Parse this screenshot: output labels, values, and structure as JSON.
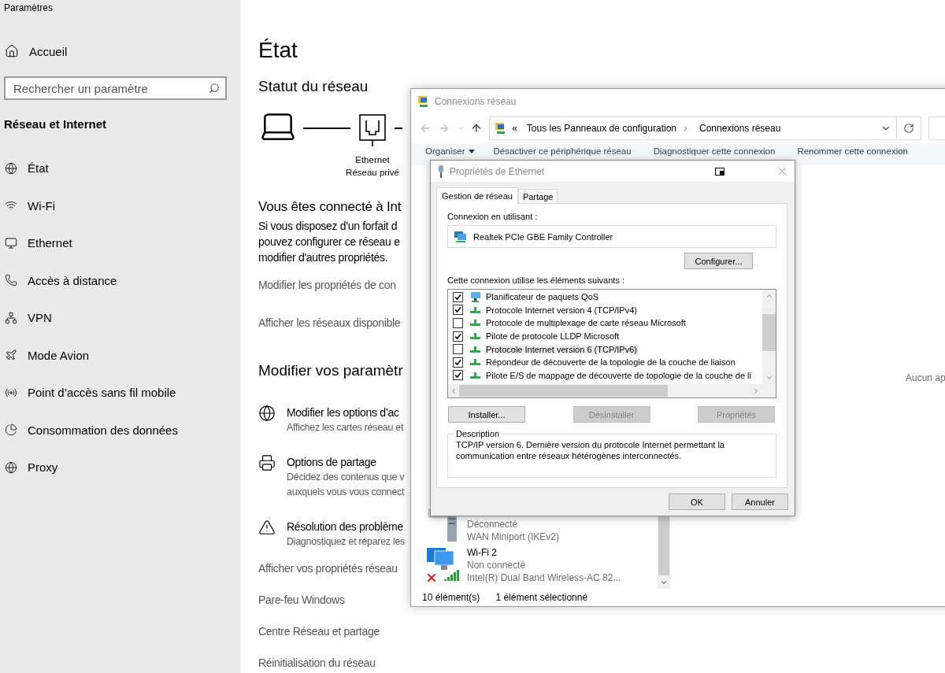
{
  "settings": {
    "title": "Paramètres",
    "home": "Accueil",
    "search": {
      "placeholder": "Rechercher un paramètre"
    },
    "section": "Réseau et Internet",
    "nav": [
      {
        "label": "État"
      },
      {
        "label": "Wi-Fi"
      },
      {
        "label": "Ethernet"
      },
      {
        "label": "Accès à distance"
      },
      {
        "label": "VPN"
      },
      {
        "label": "Mode Avion"
      },
      {
        "label": "Point d’accès sans fil mobile"
      },
      {
        "label": "Consommation des données"
      },
      {
        "label": "Proxy"
      }
    ]
  },
  "page": {
    "title": "État",
    "status_heading": "Statut du réseau",
    "adapter": "Ethernet",
    "network": "Réseau privé",
    "connected_heading": "Vous êtes connecté à Int",
    "connected_lines": [
      "Si vous disposez d'un forfait d",
      "pouvez configurer ce réseau e",
      "modifier d'autres propriétés."
    ],
    "links": [
      "Modifier les propriétés de con",
      "Afficher les réseaux disponible"
    ],
    "change_heading": "Modifier vos paramètr",
    "options": [
      {
        "title": "Modifier les options d’ac",
        "lines": [
          "Affichez les cartes réseau et"
        ]
      },
      {
        "title": "Options de partage",
        "lines": [
          "Décidez des contenus que v",
          "auxquels vous vous connect"
        ]
      },
      {
        "title": "Résolution des problème",
        "lines": [
          "Diagnostiquez et réparez les"
        ]
      }
    ],
    "bottom_links": [
      "Afficher vos propriétés réseau",
      "Pare-feu Windows",
      "Centre Réseau et partage",
      "Réinitialisation du réseau"
    ]
  },
  "connections_window": {
    "title": "Connexions réseau",
    "breadcrumb_prefix": "«",
    "breadcrumb": [
      "Tous les Panneaux de configuration",
      "Connexions réseau"
    ],
    "toolbar": [
      "Organiser",
      "Désactiver ce périphérique réseau",
      "Diagnostiquer cette connexion",
      "Renommer cette connexion"
    ],
    "items": [
      {
        "kind": "wan",
        "lines": [
          "Déconnecté",
          "WAN Miniport (IKEv2)"
        ],
        "disconnected": false
      },
      {
        "kind": "wifi",
        "name": "Wi-Fi 2",
        "lines": [
          "Non connecté",
          "Intel(R) Dual Band Wireless-AC 82..."
        ],
        "disconnected": true
      }
    ],
    "side_note": "Aucun ap",
    "status_bar": [
      "10 élément(s)",
      "1 élément sélectionné"
    ]
  },
  "dialog": {
    "title": "Propriétés de Ethernet",
    "tabs": [
      {
        "label": "Gestion de réseau",
        "selected": true
      },
      {
        "label": "Partage",
        "selected": false
      }
    ],
    "using_label": "Connexion en utilisant :",
    "adapter": "Realtek PCIe GBE Family Controller",
    "configure": "Configurer...",
    "elements_label": "Cette connexion utilise les éléments suivants :",
    "components": [
      {
        "kind": "scheduler",
        "label": "Planificateur de paquets QoS",
        "checked": true,
        "selected": false
      },
      {
        "kind": "protocol",
        "label": "Protocole Internet version 4 (TCP/IPv4)",
        "checked": true,
        "selected": false
      },
      {
        "kind": "protocol",
        "label": "Protocole de multiplexage de carte réseau Microsoft",
        "checked": false,
        "selected": false
      },
      {
        "kind": "protocol",
        "label": "Pilote de protocole LLDP Microsoft",
        "checked": true,
        "selected": false
      },
      {
        "kind": "protocol",
        "label": "Protocole Internet version 6 (TCP/IPv6)",
        "checked": false,
        "selected": true
      },
      {
        "kind": "protocol",
        "label": "Répondeur de découverte de la topologie de la couche de liaison",
        "checked": true,
        "selected": false
      },
      {
        "kind": "protocol",
        "label": "Pilote E/S de mappage de découverte de topologie de la couche de li",
        "checked": true,
        "selected": false
      }
    ],
    "actions": [
      {
        "label": "Installer...",
        "disabled": false
      },
      {
        "label": "Désinstaller",
        "disabled": true
      },
      {
        "label": "Propriétés",
        "disabled": true
      }
    ],
    "description_label": "Description",
    "description": "TCP/IP version 6. Dernière version du protocole Internet permettant la communication entre réseaux hétérogènes interconnectés.",
    "buttons": [
      "OK",
      "Annuler"
    ]
  }
}
